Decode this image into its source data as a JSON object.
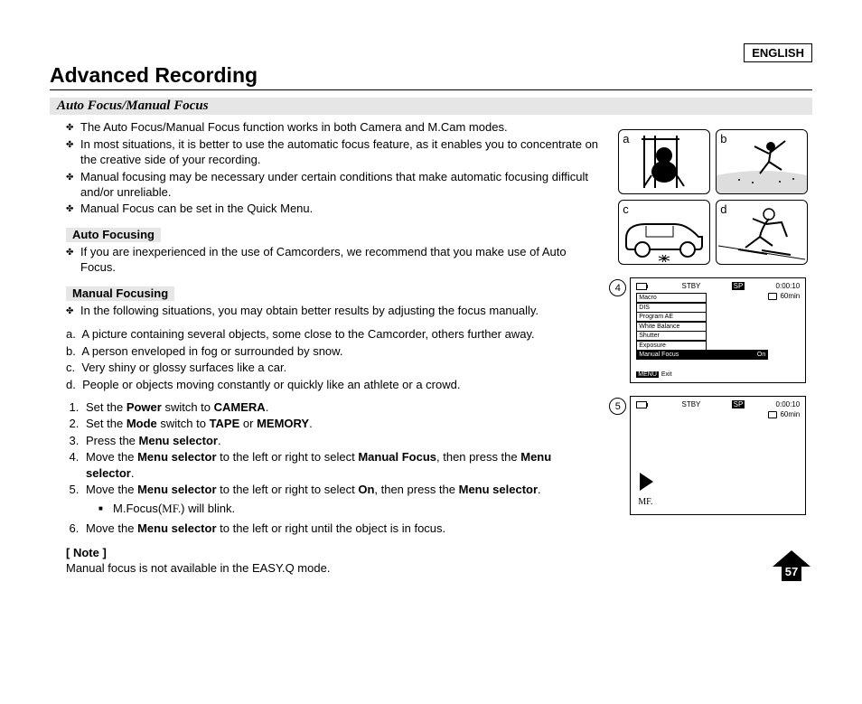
{
  "language": "ENGLISH",
  "title": "Advanced Recording",
  "subheading": "Auto Focus/Manual Focus",
  "intro_bullets": [
    "The Auto Focus/Manual Focus function works in both Camera and M.Cam modes.",
    "In most situations, it is better to use the automatic focus feature, as it enables you to concentrate on the creative side of your recording.",
    "Manual focusing may be necessary under certain conditions that make automatic focusing difficult and/or unreliable.",
    "Manual Focus can be set in the Quick Menu."
  ],
  "auto_label": "Auto Focusing",
  "auto_bullet": "If you are inexperienced in the use of Camcorders, we recommend that you make use of Auto Focus.",
  "manual_label": "Manual Focusing",
  "manual_bullet": "In the following situations, you may obtain better results by adjusting the focus manually.",
  "situations": {
    "a": "A picture containing several objects, some close to the Camcorder, others further away.",
    "b": "A person enveloped in fog or surrounded by snow.",
    "c": "Very shiny or glossy surfaces like a car.",
    "d": "People or objects moving constantly or quickly like an athlete or a crowd."
  },
  "steps": {
    "s1": {
      "pre": "Set the ",
      "b1": "Power",
      "mid": " switch to ",
      "b2": "CAMERA",
      "post": "."
    },
    "s2": {
      "pre": "Set the ",
      "b1": "Mode",
      "mid": " switch to ",
      "b2": "TAPE",
      "mid2": " or ",
      "b3": "MEMORY",
      "post": "."
    },
    "s3": {
      "pre": "Press the ",
      "b1": "Menu selector",
      "post": "."
    },
    "s4": {
      "pre": "Move the ",
      "b1": "Menu selector",
      "mid": " to the left or right to select ",
      "b2": "Manual Focus",
      "mid2": ", then press the ",
      "b3": "Menu selector",
      "post": "."
    },
    "s5": {
      "pre": "Move the ",
      "b1": "Menu selector",
      "mid": " to the left or right to select ",
      "b2": "On",
      "mid2": ", then press the ",
      "b3": "Menu selector",
      "post": "."
    },
    "s5sub": {
      "pre": "M.Focus(",
      "icon": "MF.",
      "post": ") will blink."
    },
    "s6": {
      "pre": "Move the ",
      "b1": "Menu selector",
      "post": " to the left or right until the object is in focus."
    }
  },
  "note_label": "[ Note ]",
  "note_text": "Manual focus is not available in the EASY.Q mode.",
  "illus_labels": {
    "a": "a",
    "b": "b",
    "c": "c",
    "d": "d"
  },
  "callout4": "4",
  "callout5": "5",
  "lcd": {
    "stby": "STBY",
    "sp": "SP",
    "time": "0:00:10",
    "remain": "60min",
    "menu": [
      "Macro",
      "DIS",
      "Program AE",
      "White Balance",
      "Shutter",
      "Exposure"
    ],
    "menu_sel": "Manual Focus",
    "menu_on": "On",
    "menu_btn": "MENU",
    "exit": "Exit",
    "mf": "MF."
  },
  "page_number": "57"
}
